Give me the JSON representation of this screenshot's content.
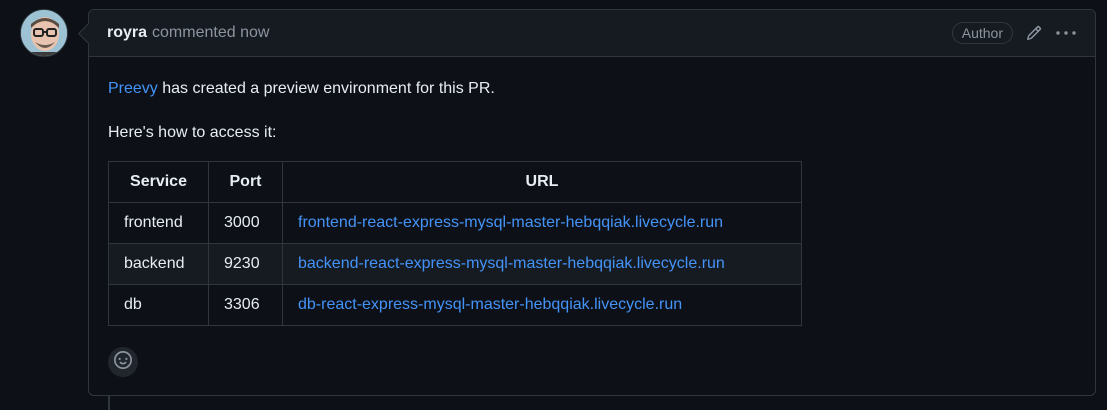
{
  "comment": {
    "author": "royra",
    "action": "commented now",
    "badge": "Author",
    "body": {
      "link_text": "Preevy",
      "intro_rest": " has created a preview environment for this PR.",
      "access_text": "Here's how to access it:"
    },
    "table": {
      "headers": [
        "Service",
        "Port",
        "URL"
      ],
      "rows": [
        [
          "frontend",
          "3000",
          "frontend-react-express-mysql-master-hebqqiak.livecycle.run"
        ],
        [
          "backend",
          "9230",
          "backend-react-express-mysql-master-hebqqiak.livecycle.run"
        ],
        [
          "db",
          "3306",
          "db-react-express-mysql-master-hebqqiak.livecycle.run"
        ]
      ]
    }
  },
  "icons": {
    "edit": "pencil-icon",
    "more": "kebab-horizontal-icon",
    "reaction": "smiley-icon"
  },
  "colors": {
    "background": "#0d1117",
    "header_bg": "#161b22",
    "border": "#30363d",
    "link": "#4493f8",
    "muted": "#8b949e"
  }
}
